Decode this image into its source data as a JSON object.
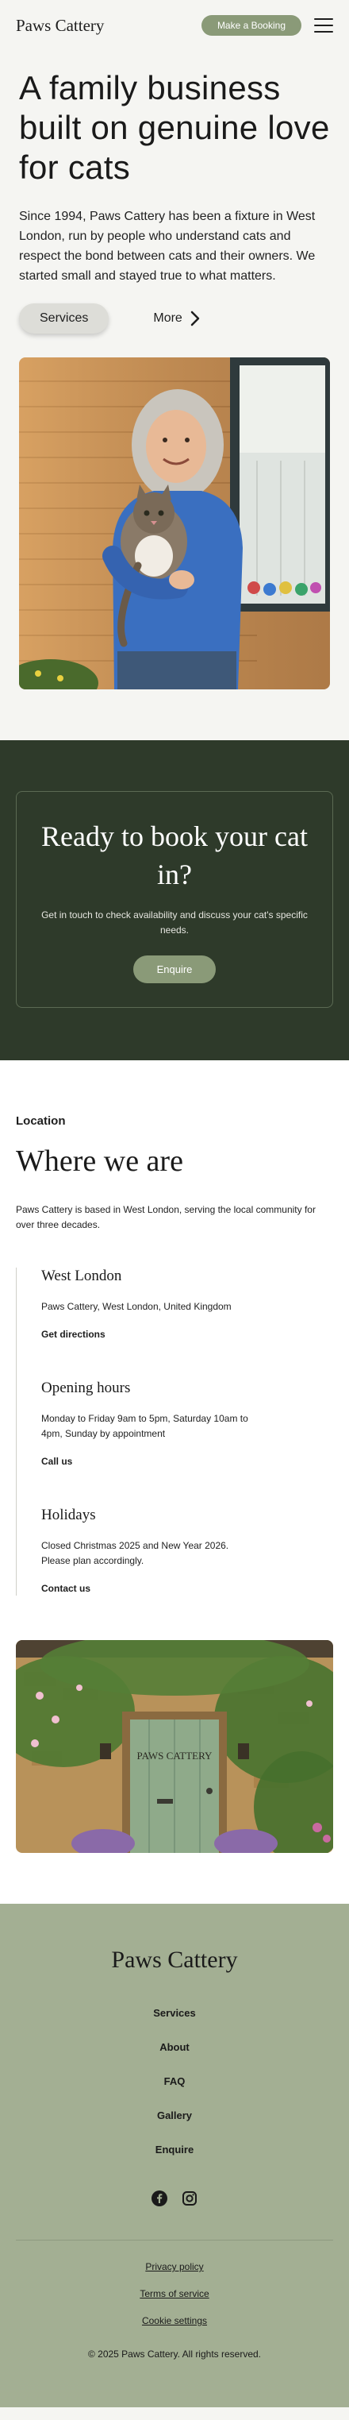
{
  "header": {
    "logo": "Paws Cattery",
    "book_button": "Make a Booking",
    "menu_icon": "hamburger-menu-icon"
  },
  "hero": {
    "title": "A family business built on genuine love for cats",
    "description": "Since 1994, Paws Cattery has been a fixture in West London, run by people who understand cats and respect the bond between cats and their owners. We started small and stayed true to what matters.",
    "primary_button": "Services",
    "secondary_link": "More"
  },
  "cta": {
    "title": "Ready to book your cat in?",
    "description": "Get in touch to check availability and discuss your cat's specific needs.",
    "button": "Enquire"
  },
  "location": {
    "tagline": "Location",
    "title": "Where we are",
    "intro": "Paws Cattery is based in West London, serving the local community for over three decades.",
    "items": [
      {
        "heading": "West London",
        "text": "Paws Cattery, West London, United Kingdom",
        "link": "Get directions"
      },
      {
        "heading": "Opening hours",
        "text": "Monday to Friday 9am to 5pm, Saturday 10am to 4pm, Sunday by appointment",
        "link": "Call us"
      },
      {
        "heading": "Holidays",
        "text": "Closed Christmas 2025 and New Year 2026. Please plan accordingly.",
        "link": "Contact us"
      }
    ],
    "door_sign": "PAWS CATTERY"
  },
  "footer": {
    "logo": "Paws Cattery",
    "nav": [
      "Services",
      "About",
      "FAQ",
      "Gallery",
      "Enquire"
    ],
    "social_icons": [
      "facebook-icon",
      "instagram-icon"
    ],
    "legal": [
      "Privacy policy",
      "Terms of service",
      "Cookie settings"
    ],
    "copyright": "© 2025 Paws Cattery. All rights reserved."
  },
  "colors": {
    "accent_green": "#8a9a78",
    "dark_green": "#2e3a2a",
    "footer_green": "#a3af93",
    "page_bg": "#f5f5f2"
  }
}
